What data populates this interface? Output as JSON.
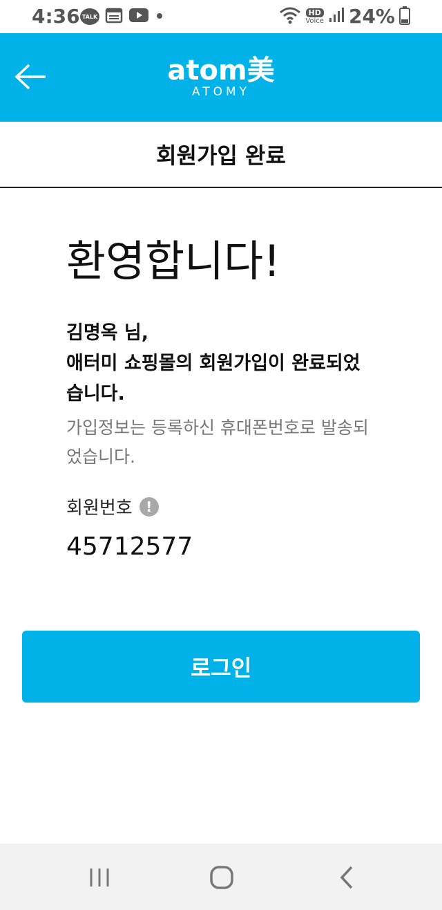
{
  "status_bar": {
    "time": "4:36",
    "notification_icons": [
      "talk-icon",
      "calendar-icon",
      "youtube-icon",
      "dot-icon"
    ],
    "talk_label": "TALK",
    "hd_label": "HD",
    "voice_label": "Voice",
    "battery": "24%"
  },
  "header": {
    "logo_main": "atom美",
    "logo_sub": "ATOMY",
    "brand_color": "#00b2e8"
  },
  "page": {
    "title": "회원가입 완료",
    "welcome": "환영합니다!",
    "message_name": "김명옥 님,",
    "message_body": "애터미 쇼핑몰의 회원가입이 완료되었습니다.",
    "sub_message": "가입정보는 등록하신 휴대폰번호로 발송되었습니다.",
    "member_label": "회원번호",
    "info_icon_glyph": "!",
    "member_number": "45712577",
    "login_label": "로그인"
  },
  "nav": {
    "recent_apps": "recent-apps-icon",
    "home": "home-icon",
    "back": "back-icon"
  }
}
